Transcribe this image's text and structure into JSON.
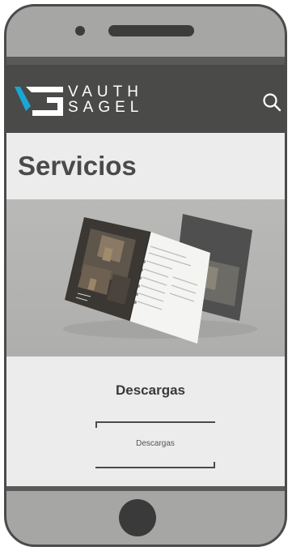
{
  "brand": {
    "logo_line1": "VAUTH",
    "logo_line2": "SAGEL",
    "accent_color": "#1aa6d6"
  },
  "header": {
    "search_icon": "search-icon"
  },
  "page": {
    "title": "Servicios"
  },
  "hero": {
    "image": "brochure-image"
  },
  "section": {
    "heading": "Descargas",
    "link_label": "Descargas"
  }
}
